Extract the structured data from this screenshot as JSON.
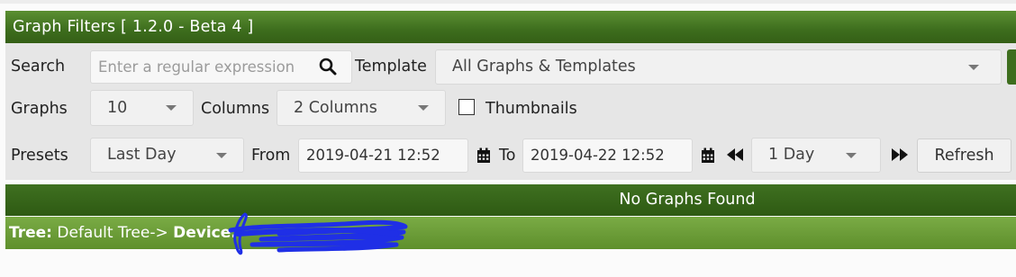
{
  "panel": {
    "title": "Graph Filters [ 1.2.0 - Beta 4 ]",
    "search_label": "Search",
    "search_placeholder": "Enter a regular expression",
    "template_label": "Template",
    "template_value": "All Graphs & Templates",
    "graphs_label": "Graphs",
    "graphs_value": "10",
    "columns_label": "Columns",
    "columns_value": "2 Columns",
    "thumbnails_label": "Thumbnails",
    "thumbnails_checked": false,
    "presets_label": "Presets",
    "presets_value": "Last Day",
    "from_label": "From",
    "from_value": "2019-04-21 12:52",
    "to_label": "To",
    "to_value": "2019-04-22 12:52",
    "timespan_value": "1 Day",
    "refresh_label": "Refresh"
  },
  "result": {
    "message": "No Graphs Found"
  },
  "tree": {
    "tree_label": "Tree:",
    "tree_value": "Default Tree->",
    "device_label": "Device:"
  },
  "colors": {
    "header_green": "#3d6d1d",
    "tree_green": "#6b9d38",
    "redaction_blue": "#1f2fe6"
  },
  "icons": [
    "search-icon",
    "calendar-icon",
    "rewind-icon",
    "fast-forward-icon",
    "chevron-down-icon"
  ]
}
